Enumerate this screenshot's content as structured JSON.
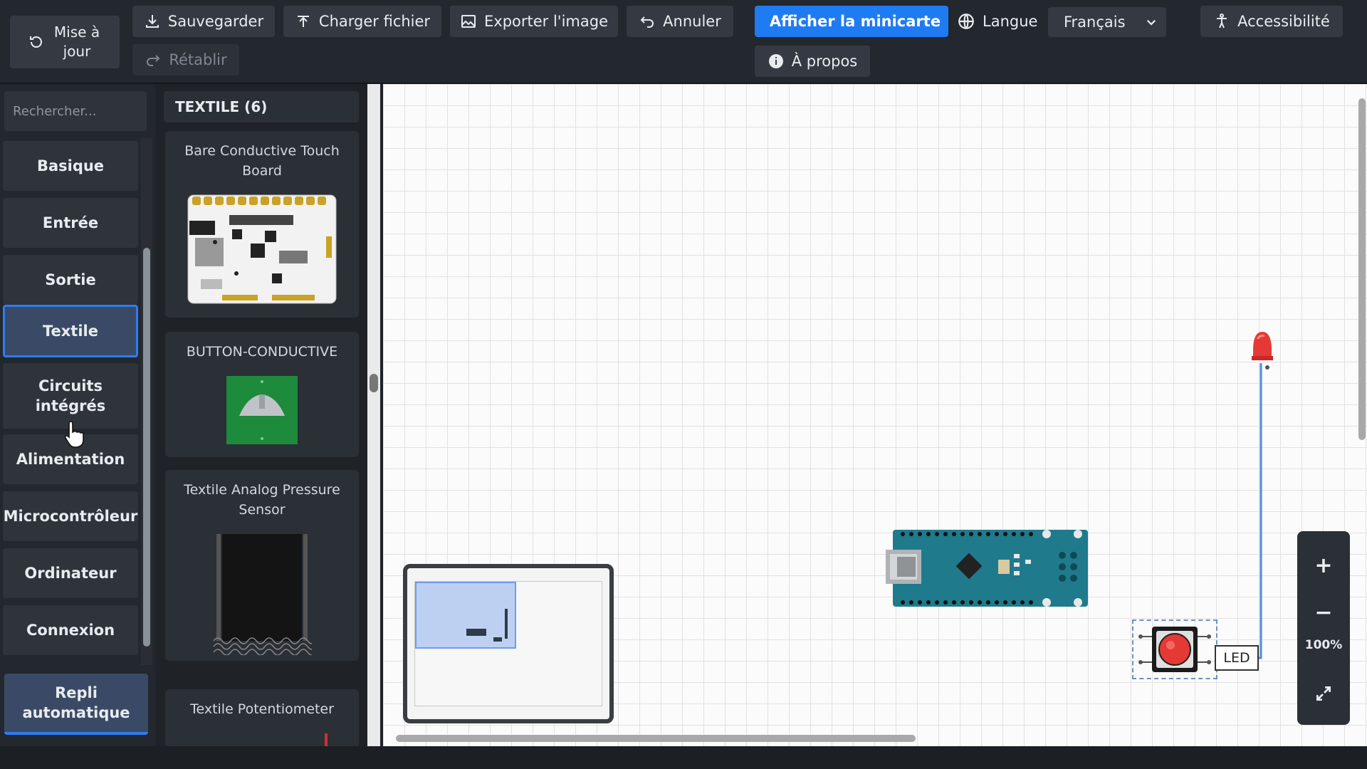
{
  "toolbar": {
    "refresh_label": "Mise à jour",
    "save_label": "Sauvegarder",
    "load_label": "Charger fichier",
    "export_label": "Exporter l'image",
    "undo_label": "Annuler",
    "redo_label": "Rétablir",
    "minimap_label": "Afficher la minicarte",
    "language_label": "Langue",
    "language_value": "Français",
    "accessibility_label": "Accessibilité",
    "about_label": "À propos"
  },
  "search": {
    "placeholder": "Rechercher..."
  },
  "categories": [
    {
      "label": "Basique"
    },
    {
      "label": "Entrée"
    },
    {
      "label": "Sortie"
    },
    {
      "label": "Textile"
    },
    {
      "label": "Circuits intégrés"
    },
    {
      "label": "Alimentation"
    },
    {
      "label": "Microcontrôleur"
    },
    {
      "label": "Ordinateur"
    },
    {
      "label": "Connexion"
    }
  ],
  "active_category": "Textile",
  "auto_collapse_label": "Repli automatique",
  "component_panel": {
    "header": "TEXTILE (6)",
    "items": [
      {
        "name": "Bare Conductive Touch Board"
      },
      {
        "name": "BUTTON-CONDUCTIVE"
      },
      {
        "name": "Textile Analog Pressure Sensor"
      },
      {
        "name": "Textile Potentiometer"
      }
    ]
  },
  "canvas": {
    "led_label": "LED",
    "zoom_level": "100%"
  },
  "colors": {
    "accent": "#1f7bf2",
    "led_red": "#e53935",
    "board_teal": "#1f7a8c",
    "wire_blue": "#4a8de0"
  }
}
